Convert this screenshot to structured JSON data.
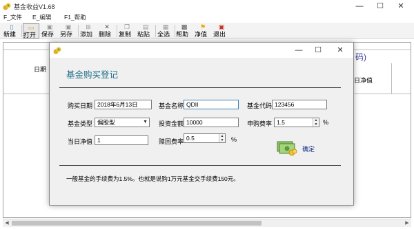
{
  "main_window": {
    "title": "基金收益V1.68",
    "controls": {
      "minimize": "—",
      "maximize": "☐",
      "close": "✕"
    }
  },
  "menu": [
    {
      "label": "F_文件"
    },
    {
      "label": "E_编辑"
    },
    {
      "label": "F1_帮助"
    }
  ],
  "toolbar": [
    {
      "label": "新建",
      "icon": "new-file-icon",
      "glyph": "▯",
      "enabled": true
    },
    {
      "label": "打开",
      "icon": "open-folder-icon",
      "glyph": "▭",
      "enabled": true
    },
    {
      "label": "保存",
      "icon": "save-icon",
      "glyph": "▣",
      "enabled": false
    },
    {
      "label": "另存",
      "icon": "save-as-icon",
      "glyph": "▣",
      "enabled": false
    },
    {
      "label": "添加",
      "icon": "add-icon",
      "glyph": "⊞",
      "enabled": false
    },
    {
      "label": "删除",
      "icon": "delete-icon",
      "glyph": "✕",
      "enabled": false
    },
    {
      "label": "复制",
      "icon": "copy-icon",
      "glyph": "❐",
      "enabled": false
    },
    {
      "label": "粘贴",
      "icon": "paste-icon",
      "glyph": "▤",
      "enabled": false
    },
    {
      "label": "全选",
      "icon": "select-all-icon",
      "glyph": "▦",
      "enabled": false
    },
    {
      "label": "帮助",
      "icon": "help-icon",
      "glyph": "▩",
      "enabled": true
    },
    {
      "label": "净值",
      "icon": "flag-icon",
      "glyph": "⚑",
      "enabled": true
    },
    {
      "label": "退出",
      "icon": "exit-icon",
      "glyph": "▣",
      "enabled": true
    }
  ],
  "grid": {
    "col_date": "日期",
    "col_nav": "日净值",
    "partial_header": "码)"
  },
  "dialog": {
    "heading": "基金购买登记",
    "controls": {
      "minimize": "—",
      "maximize": "☐",
      "close": "✕"
    },
    "fields": {
      "buy_date": {
        "label": "购买日期",
        "value": "2018年6月13日"
      },
      "fund_name": {
        "label": "基金名称",
        "value": "QDII"
      },
      "fund_code": {
        "label": "基金代码",
        "value": "123456"
      },
      "fund_type": {
        "label": "基金类型",
        "value": "偏股型"
      },
      "amount": {
        "label": "投资金额",
        "value": "10000"
      },
      "purchase_rate": {
        "label": "申购费率",
        "value": "1.5",
        "unit": "%"
      },
      "nav": {
        "label": "当日净值",
        "value": "1"
      },
      "redeem_rate": {
        "label": "赎回费率",
        "value": "0.5",
        "unit": "%"
      }
    },
    "confirm_label": "确定",
    "note": "一般基金的手续费为1.5%。也就是说购1万元基金交手续费150元。"
  }
}
